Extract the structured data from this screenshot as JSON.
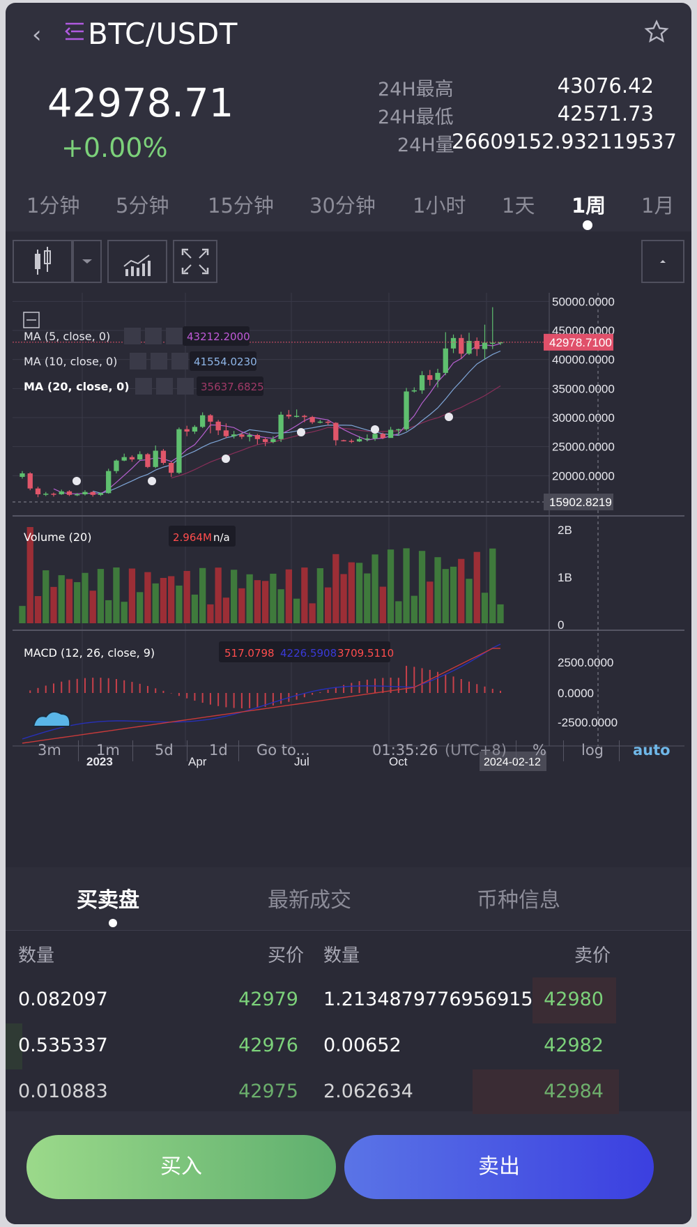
{
  "header": {
    "pair": "BTC/USDT",
    "back_icon": "chevron-left-icon",
    "menu_icon": "menu-icon",
    "star_icon": "star-icon"
  },
  "ticker": {
    "price": "42978.71",
    "change": "+0.00%",
    "high_label": "24H最高",
    "high_value": "43076.42",
    "low_label": "24H最低",
    "low_value": "42571.73",
    "vol_label": "24H量",
    "vol_value": "26609152.932119537"
  },
  "intervals": [
    "1分钟",
    "5分钟",
    "15分钟",
    "30分钟",
    "1小时",
    "1天",
    "1周",
    "1月"
  ],
  "active_interval": "1周",
  "toolbar": {
    "candle_icon": "candlestick-icon",
    "dropdown_icon": "chevron-down-icon",
    "indicator_icon": "indicator-icon",
    "fullscreen_icon": "fullscreen-icon",
    "collapse_icon": "triangle-up-icon"
  },
  "chart": {
    "price_labels": [
      "50000.0000",
      "45000.0000",
      "40000.0000",
      "35000.0000",
      "30000.0000",
      "25000.0000",
      "20000.0000"
    ],
    "current_price_tag": "42978.7100",
    "low_tag": "15902.8219",
    "indicators": [
      {
        "name": "MA (5, close, 0)",
        "value": "43212.2000",
        "color": "#c05ad8"
      },
      {
        "name": "MA (10, close, 0)",
        "value": "41554.0230",
        "color": "#8fb6e8"
      },
      {
        "name": "MA (20, close, 0)",
        "value": "35637.6825",
        "color": "#a03a68"
      }
    ],
    "volume": {
      "name": "Volume (20)",
      "value": "2.964M",
      "value2": "n/a",
      "labels": [
        "2B",
        "1B",
        "0"
      ]
    },
    "macd": {
      "name": "MACD (12, 26, close, 9)",
      "v1": "517.0798",
      "v2": "4226.5908",
      "v3": "3709.5110",
      "labels": [
        "2500.0000",
        "0.0000",
        "-2500.0000"
      ]
    },
    "time_labels": [
      "2023",
      "Apr",
      "Jul",
      "Oct"
    ],
    "date_tag": "2024-02-12",
    "ranges": [
      "3m",
      "1m",
      "5d",
      "1d",
      "Go to..."
    ],
    "clock": "01:35:26",
    "timezone": "(UTC+8)",
    "options": [
      "%",
      "log",
      "auto"
    ]
  },
  "chart_data": {
    "type": "candlestick",
    "ylim": [
      15000,
      51000
    ],
    "candles": [
      [
        19800,
        20400,
        19500,
        20800
      ],
      [
        20400,
        17800,
        17500,
        20600
      ],
      [
        17800,
        16800,
        16300,
        18100
      ],
      [
        16800,
        16900,
        16500,
        17200
      ],
      [
        16900,
        16800,
        16400,
        17100
      ],
      [
        16800,
        17300,
        16700,
        17600
      ],
      [
        17300,
        16700,
        16500,
        17500
      ],
      [
        16700,
        16800,
        16500,
        17000
      ],
      [
        16800,
        17200,
        16600,
        17500
      ],
      [
        17200,
        16700,
        16400,
        17300
      ],
      [
        16700,
        17000,
        16500,
        17100
      ],
      [
        17000,
        20800,
        16900,
        21200
      ],
      [
        20800,
        22600,
        20400,
        22800
      ],
      [
        22600,
        23200,
        22500,
        23800
      ],
      [
        23200,
        22800,
        22400,
        23500
      ],
      [
        22800,
        23700,
        22600,
        24200
      ],
      [
        23700,
        21500,
        21300,
        23900
      ],
      [
        21500,
        24300,
        21300,
        25200
      ],
      [
        24300,
        22200,
        21900,
        24600
      ],
      [
        22200,
        20500,
        19800,
        22400
      ],
      [
        20500,
        28000,
        20300,
        28300
      ],
      [
        28000,
        27600,
        26800,
        28600
      ],
      [
        27600,
        28400,
        27200,
        28700
      ],
      [
        28400,
        30400,
        28200,
        30900
      ],
      [
        30400,
        29300,
        27300,
        30600
      ],
      [
        29300,
        27800,
        27000,
        29600
      ],
      [
        27800,
        26800,
        26500,
        29000
      ],
      [
        26800,
        27100,
        26400,
        27700
      ],
      [
        27100,
        26700,
        26300,
        27400
      ],
      [
        26700,
        27000,
        25900,
        27400
      ],
      [
        27000,
        26300,
        25400,
        27200
      ],
      [
        26300,
        25800,
        25100,
        26600
      ],
      [
        25800,
        26300,
        25600,
        26800
      ],
      [
        26300,
        30500,
        25800,
        31000
      ],
      [
        30500,
        30200,
        29800,
        31300
      ],
      [
        30200,
        30300,
        30000,
        31400
      ],
      [
        30300,
        30100,
        29200,
        30500
      ],
      [
        30100,
        29200,
        28900,
        30300
      ],
      [
        29200,
        29300,
        29000,
        29600
      ],
      [
        29300,
        29100,
        28700,
        29500
      ],
      [
        29100,
        26100,
        25200,
        29200
      ],
      [
        26100,
        26000,
        25900,
        26200
      ],
      [
        26000,
        25900,
        25600,
        26300
      ],
      [
        25900,
        26300,
        25800,
        26800
      ],
      [
        26300,
        26400,
        25900,
        27100
      ],
      [
        26400,
        27200,
        26000,
        27600
      ],
      [
        27200,
        26500,
        26300,
        27400
      ],
      [
        26500,
        27900,
        26700,
        28400
      ],
      [
        27900,
        28000,
        26900,
        28100
      ],
      [
        28000,
        34500,
        27700,
        35100
      ],
      [
        34500,
        34700,
        34300,
        35200
      ],
      [
        34700,
        37300,
        34100,
        38000
      ],
      [
        37300,
        36500,
        35500,
        38200
      ],
      [
        36500,
        37700,
        35200,
        38400
      ],
      [
        37700,
        41900,
        37300,
        44700
      ],
      [
        41900,
        43700,
        41100,
        44300
      ],
      [
        43700,
        41000,
        40200,
        44300
      ],
      [
        41000,
        43200,
        40800,
        44600
      ],
      [
        43200,
        41800,
        40600,
        43800
      ],
      [
        41800,
        42900,
        40100,
        46000
      ],
      [
        42900,
        42900,
        41800,
        49000
      ],
      [
        42900,
        42979,
        42500,
        43000
      ]
    ]
  }
}
